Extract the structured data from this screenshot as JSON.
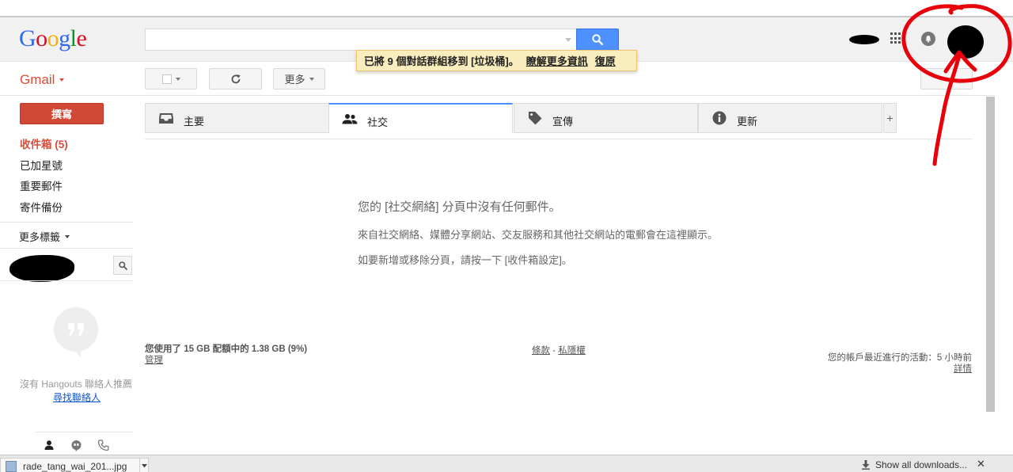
{
  "header": {
    "logo_letters": [
      {
        "ch": "G",
        "color": "#3369e8"
      },
      {
        "ch": "o",
        "color": "#d50f25"
      },
      {
        "ch": "o",
        "color": "#eeb211"
      },
      {
        "ch": "g",
        "color": "#3369e8"
      },
      {
        "ch": "l",
        "color": "#009925"
      },
      {
        "ch": "e",
        "color": "#d50f25"
      }
    ],
    "search": {
      "value": "",
      "placeholder": ""
    }
  },
  "notice": {
    "message": "已將 9 個對話群組移到 [垃圾桶]。",
    "learn_more": "瞭解更多資訊",
    "undo": "復原"
  },
  "toolbar": {
    "gmail_label": "Gmail",
    "more_label": "更多"
  },
  "sidebar": {
    "compose_label": "撰寫",
    "items": [
      {
        "label": "收件箱 (5)"
      },
      {
        "label": "已加星號"
      },
      {
        "label": "重要郵件"
      },
      {
        "label": "寄件備份"
      }
    ],
    "more_labels": "更多標籤",
    "hangouts": {
      "no_contacts": "沒有 Hangouts 聯絡人推薦",
      "find_contacts": "尋找聯絡人"
    }
  },
  "tabs": [
    {
      "label": "主要",
      "icon": "inbox-icon"
    },
    {
      "label": "社交",
      "icon": "people-icon"
    },
    {
      "label": "宣傳",
      "icon": "tag-icon"
    },
    {
      "label": "更新",
      "icon": "info-icon"
    }
  ],
  "main": {
    "empty_title": "您的 [社交網絡] 分頁中沒有任何郵件。",
    "empty_line1": "來自社交網絡、媒體分享網站、交友服務和其他社交網站的電郵會在這裡顯示。",
    "empty_line2": "如要新增或移除分頁，請按一下 [收件箱設定]。"
  },
  "footer": {
    "storage": "您使用了 15 GB 配額中的 1.38 GB (9%)",
    "manage": "管理",
    "terms": "條款",
    "separator": " - ",
    "privacy": "私隱權",
    "activity": "您的帳戶最近進行的活動：5 小時前",
    "details": "詳情"
  },
  "downloads": {
    "file_name": "rade_tang_wai_201...jpg",
    "show_all": "Show all downloads..."
  },
  "colors": {
    "accent_red": "#dd4b39",
    "compose_red": "#d14836",
    "search_blue": "#4d90fe",
    "notice_bg": "#f9edbe",
    "annotation_red": "#e8000b"
  }
}
